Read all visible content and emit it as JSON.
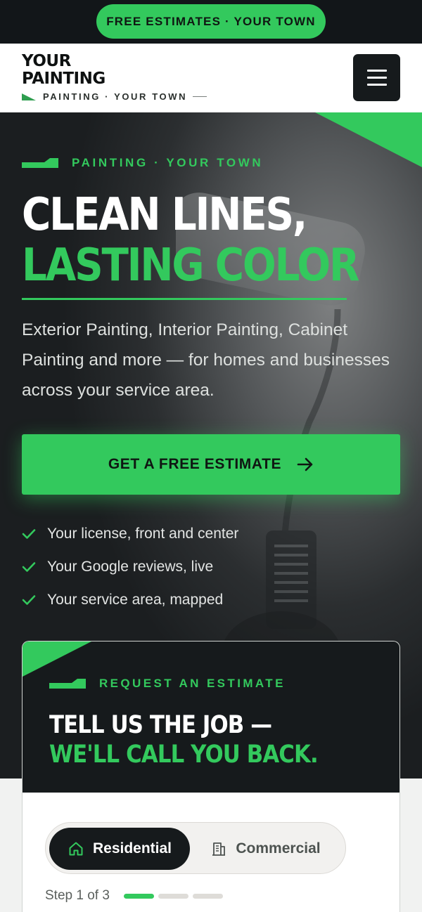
{
  "topbar": {
    "promo_label": "FREE ESTIMATES · YOUR TOWN"
  },
  "header": {
    "logo_line1": "YOUR",
    "logo_line2": "PAINTING",
    "logo_tagline": "PAINTING · YOUR TOWN",
    "menu_icon": "hamburger-icon"
  },
  "hero": {
    "eyebrow": "PAINTING · YOUR TOWN",
    "headline_line1": "CLEAN LINES,",
    "headline_line2": "LASTING COLOR",
    "description": "Exterior Painting, Interior Painting, Cabinet Painting and more — for homes and businesses across your service area.",
    "cta_label": "GET A FREE ESTIMATE",
    "cta_icon": "arrow-right-icon",
    "checks": [
      "Your license, front and center",
      "Your Google reviews, live",
      "Your service area, mapped"
    ]
  },
  "estimate_card": {
    "eyebrow": "REQUEST AN ESTIMATE",
    "title_line1": "TELL US THE JOB —",
    "title_line2": "WE'LL CALL YOU BACK.",
    "segments": [
      {
        "label": "Residential",
        "icon": "home-icon",
        "active": true
      },
      {
        "label": "Commercial",
        "icon": "building-icon",
        "active": false
      }
    ],
    "step_label": "Step 1 of 3",
    "step_current": 1,
    "step_total": 3
  },
  "colors": {
    "accent": "#33c95d",
    "dark": "#161a1c",
    "topbar_bg": "#121619"
  }
}
